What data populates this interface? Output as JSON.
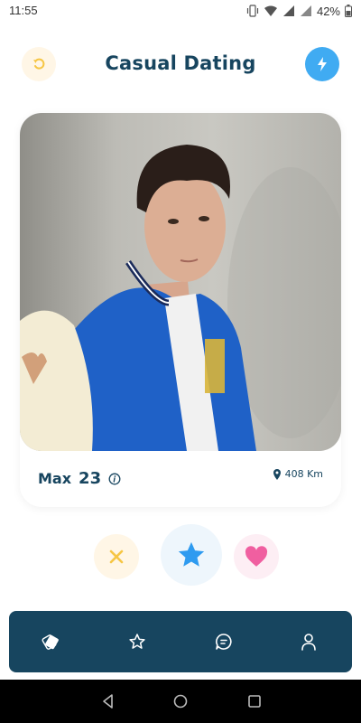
{
  "status_bar": {
    "time": "11:55",
    "battery": "42%"
  },
  "header": {
    "title": "Casual Dating"
  },
  "profile": {
    "name": "Max",
    "age": "23",
    "distance": "408 Km"
  },
  "icons": {
    "undo": "undo-icon",
    "boost": "lightning-icon",
    "info": "info-icon",
    "location": "location-pin-icon",
    "nope": "close-icon",
    "super_like": "star-icon",
    "like": "heart-icon",
    "nav": [
      "cards-icon",
      "star-outline-icon",
      "chat-icon",
      "profile-icon"
    ]
  },
  "colors": {
    "brand_dark": "#17455F",
    "accent_blue": "#40ABF2",
    "nope_yellow": "#F6C644",
    "like_pink": "#F05FA0",
    "bg_yellow": "#FFF6E6"
  }
}
